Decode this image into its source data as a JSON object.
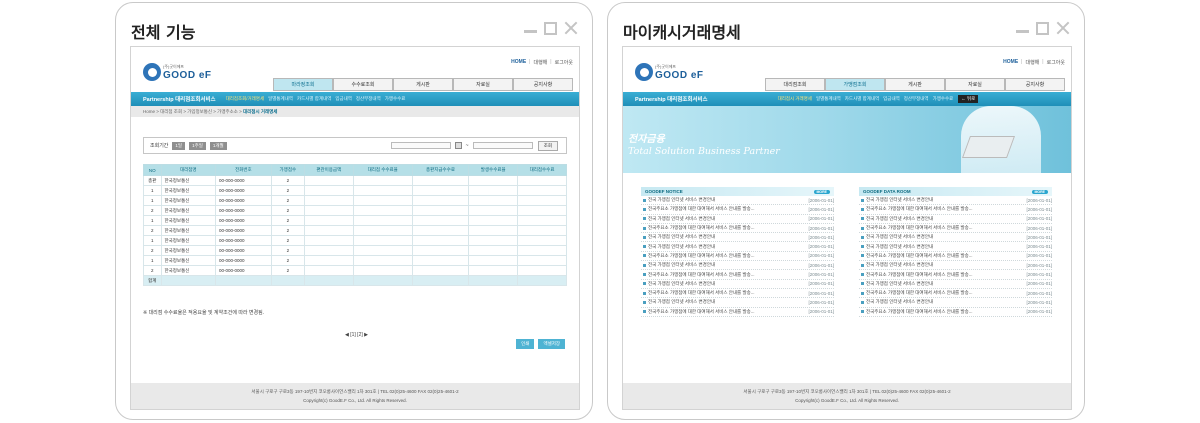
{
  "cards": [
    {
      "title": "전체 기능",
      "site": {
        "top_links": [
          "HOME",
          "대행해",
          "로그아웃"
        ],
        "logo_sub": "(주)굿이에프",
        "logo_main": "GOOD eF",
        "tabs": [
          "마라정조회",
          "수수료조회",
          "게시판",
          "자료실",
          "공지사항"
        ],
        "brand": "Partnership 대리점조회서비스",
        "subnav": [
          "대리점조회/거래명세",
          "일별통계내역",
          "카드사별 합계내역",
          "입금내역",
          "정산부정내역",
          "가맹수수료"
        ],
        "breadcrumb": "Home > 대리점 조회 > 가입정보통신 > 가맹주소소 >",
        "breadcrumb_current": "대리점시 거래명세",
        "search_label": "조회기간",
        "search_buttons": [
          "1일",
          "1주일",
          "1개월"
        ],
        "search_sep": "~",
        "search_submit": "조회",
        "columns": [
          "NO",
          "대리점명",
          "전화번호",
          "가맹점수",
          "편관이용금액",
          "대리점 수수료율",
          "총판지급수수료",
          "발생수수료율",
          "대리점수수료"
        ],
        "rows": [
          [
            "총판",
            "한국정보통신",
            "00-000-0000",
            "2"
          ],
          [
            "1",
            "한국정보통신",
            "00-000-0000",
            "2"
          ],
          [
            "1",
            "한국정보통신",
            "00-000-0000",
            "2"
          ],
          [
            "2",
            "한국정보통신",
            "00-000-0000",
            "2"
          ],
          [
            "1",
            "한국정보통신",
            "00-000-0000",
            "2"
          ],
          [
            "2",
            "한국정보통신",
            "00-000-0000",
            "2"
          ],
          [
            "1",
            "한국정보통신",
            "00-000-0000",
            "2"
          ],
          [
            "2",
            "한국정보통신",
            "00-000-0000",
            "2"
          ],
          [
            "1",
            "한국정보통신",
            "00-000-0000",
            "2"
          ],
          [
            "2",
            "한국정보통신",
            "00-000-0000",
            "2"
          ]
        ],
        "total_label": "합계",
        "note": "※ 대리점 수수료율은 적용요율 및 계약조건에 따라 변경됨.",
        "pager": "◀ [1] [2] ▶",
        "actions": [
          "인쇄",
          "엑셀저장"
        ],
        "footer_1": "서울시 구로구 구로3동 197-10번지 코오롱사이언스밸리 1차 301호 | TEL 02(0)25-4600 FAX 02(0)25-4601-2",
        "footer_2": "Copyright(c) GoodE.F Co., Ltd. All Rights Reserved."
      }
    },
    {
      "title": "마이캐시거래명세",
      "site": {
        "top_links": [
          "HOME",
          "대행해",
          "로그아웃"
        ],
        "logo_sub": "(주)굿이에프",
        "logo_main": "GOOD eF",
        "tabs": [
          "대리점조회",
          "가맹점조회",
          "게시판",
          "자료실",
          "공지사항"
        ],
        "brand": "Partnership 대리점조회서비스",
        "subnav": [
          "대리점시 거래명세",
          "일별통계내역",
          "카드사별 합계내역",
          "입금내역",
          "정산부정내역",
          "가맹수수료"
        ],
        "back": "← 뒤로",
        "hero_1": "전자금융",
        "hero_2": "Total Solution Business Partner",
        "notice_title": "GOODEF NOTICE",
        "data_title": "GOODEF DATA ROOM",
        "more": "MORE",
        "board_items": [
          [
            "전국 가맹점 인터넷 서비스 변경안내",
            "[2006-01-01]"
          ],
          [
            "전국주요소 가맹점에 대한 대여해서 서비스 안내를 발송...",
            "[2006-01-01]"
          ],
          [
            "전국 가맹점 인터넷 서비스 변경안내",
            "[2006-01-01]"
          ],
          [
            "전국주요소 가맹점에 대한 대여해서 서비스 안내를 발송...",
            "[2006-01-01]"
          ],
          [
            "전국 가맹점 인터넷 서비스 변경안내",
            "[2006-01-01]"
          ],
          [
            "전국 가맹점 인터넷 서비스 변경안내",
            "[2006-01-01]"
          ],
          [
            "전국주요소 가맹점에 대한 대여해서 서비스 안내를 발송...",
            "[2006-01-01]"
          ],
          [
            "전국 가맹점 인터넷 서비스 변경안내",
            "[2006-01-01]"
          ],
          [
            "전국주요소 가맹점에 대한 대여해서 서비스 안내를 발송...",
            "[2006-01-01]"
          ],
          [
            "전국 가맹점 인터넷 서비스 변경안내",
            "[2006-01-01]"
          ],
          [
            "전국주요소 가맹점에 대한 대여해서 서비스 안내를 발송...",
            "[2006-01-01]"
          ],
          [
            "전국 가맹점 인터넷 서비스 변경안내",
            "[2006-01-01]"
          ],
          [
            "전국주요소 가맹점에 대한 대여해서 서비스 안내를 발송...",
            "[2006-01-01]"
          ]
        ],
        "footer_1": "서울시 구로구 구로3동 197-10번지 코오롱사이언스밸리 1차 301호 | TEL 02(0)25-4600 FAX 02(0)25-4601-2",
        "footer_2": "Copyright(c) GoodE.F Co., Ltd. All Rights Reserved."
      }
    }
  ]
}
